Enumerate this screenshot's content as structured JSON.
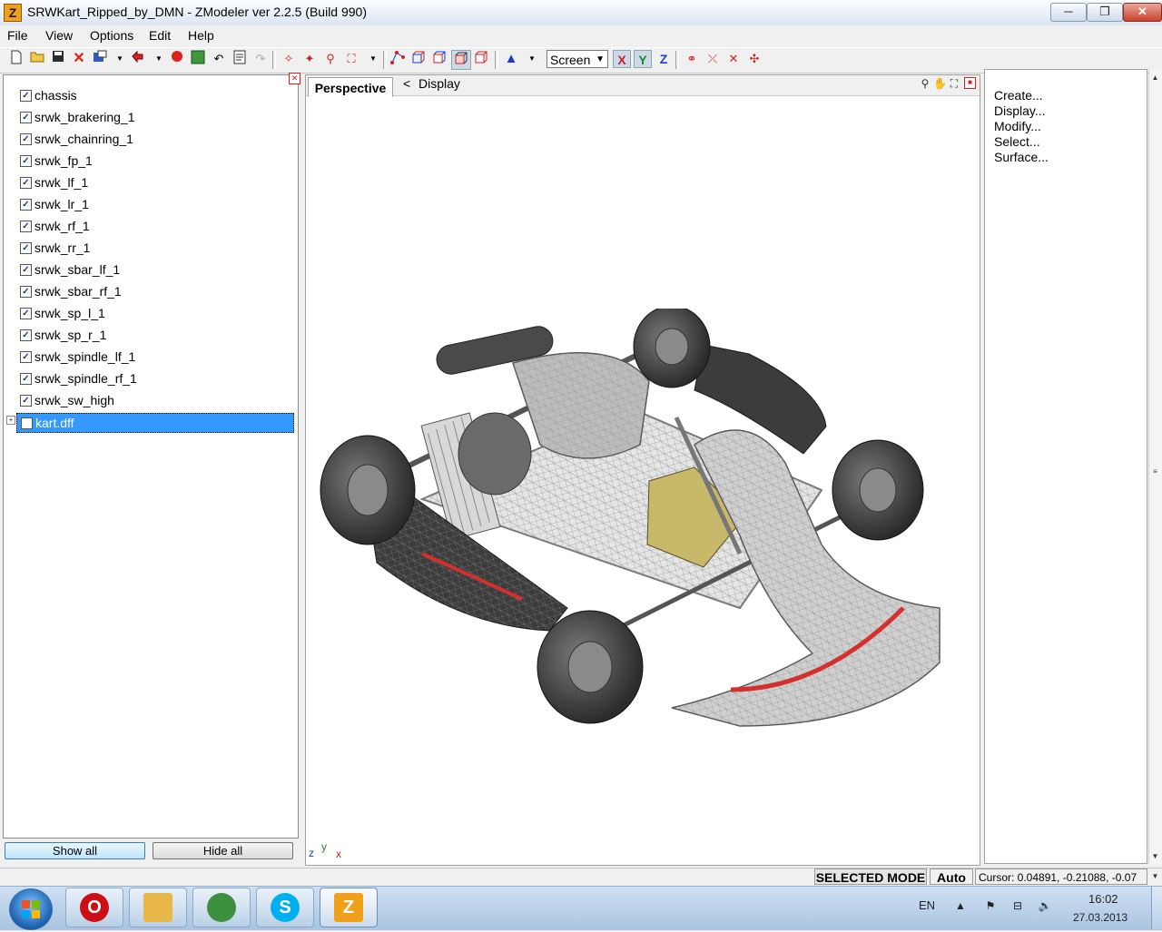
{
  "window": {
    "title": "SRWKart_Ripped_by_DMN - ZModeler ver 2.2.5 (Build 990)",
    "app_icon_glyph": "Z",
    "minimize": "─",
    "maximize": "❐",
    "close": "✕"
  },
  "menu": [
    "File",
    "View",
    "Options",
    "Edit",
    "Help"
  ],
  "toolbar": {
    "view_mode": "Screen",
    "axes": [
      "X",
      "Y",
      "Z"
    ],
    "axis_colors": {
      "X": "#c81e1e",
      "Y": "#1e8a1e",
      "Z": "#1e3ec8"
    }
  },
  "left_panel": {
    "close_glyph": "✕",
    "expander_glyph": "+",
    "objects": [
      {
        "name": "chassis",
        "checked": true
      },
      {
        "name": "srwk_brakering_1",
        "checked": true
      },
      {
        "name": "srwk_chainring_1",
        "checked": true
      },
      {
        "name": "srwk_fp_1",
        "checked": true
      },
      {
        "name": "srwk_lf_1",
        "checked": true
      },
      {
        "name": "srwk_lr_1",
        "checked": true
      },
      {
        "name": "srwk_rf_1",
        "checked": true
      },
      {
        "name": "srwk_rr_1",
        "checked": true
      },
      {
        "name": "srwk_sbar_lf_1",
        "checked": true
      },
      {
        "name": "srwk_sbar_rf_1",
        "checked": true
      },
      {
        "name": "srwk_sp_l_1",
        "checked": true
      },
      {
        "name": "srwk_sp_r_1",
        "checked": true
      },
      {
        "name": "srwk_spindle_lf_1",
        "checked": true
      },
      {
        "name": "srwk_spindle_rf_1",
        "checked": true
      },
      {
        "name": "srwk_sw_high",
        "checked": true
      },
      {
        "name": "kart.dff",
        "checked": false,
        "selected": true
      }
    ],
    "show_all": "Show all",
    "hide_all": "Hide all"
  },
  "viewport": {
    "tab": "Perspective",
    "nav_arrow": "<",
    "display": "Display",
    "gizmo": {
      "z": "z",
      "y": "y",
      "x": "x"
    }
  },
  "right_panel": {
    "items": [
      "Create...",
      "Display...",
      "Modify...",
      "Select...",
      "Surface..."
    ]
  },
  "status": {
    "mode": "SELECTED MODE",
    "auto": "Auto",
    "cursor": "Cursor: 0.04891, -0.21088, -0.07"
  },
  "taskbar": {
    "apps": [
      {
        "name": "opera",
        "glyph": "O",
        "color": "#cc0f16"
      },
      {
        "name": "explorer",
        "glyph": "",
        "color": "#e8b84a"
      },
      {
        "name": "chrome",
        "glyph": "",
        "color": "#3c8f3c"
      },
      {
        "name": "skype",
        "glyph": "S",
        "color": "#00aff0"
      },
      {
        "name": "zmodeler",
        "glyph": "Z",
        "color": "#f0a01a",
        "active": true
      }
    ],
    "lang": "EN",
    "time": "16:02",
    "date": "27.03.2013"
  }
}
